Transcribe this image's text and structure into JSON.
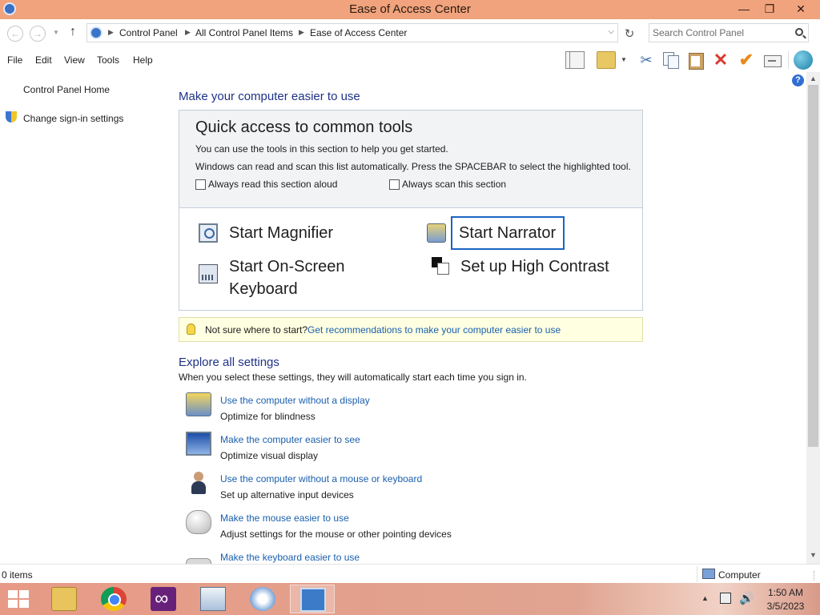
{
  "window": {
    "title": "Ease of Access Center",
    "controls": {
      "minimize": "—",
      "maximize": "❐",
      "close": "✕"
    }
  },
  "address_bar": {
    "breadcrumbs": [
      "Control Panel",
      "All Control Panel Items",
      "Ease of Access Center"
    ],
    "search_placeholder": "Search Control Panel"
  },
  "menu": [
    "File",
    "Edit",
    "View",
    "Tools",
    "Help"
  ],
  "toolbar_icons": [
    "layout-icon",
    "folder-options-icon",
    "cut-icon",
    "copy-icon",
    "paste-icon",
    "delete-icon",
    "check-icon",
    "properties-icon",
    "globe-icon"
  ],
  "sidebar": {
    "items": [
      {
        "label": "Control Panel Home"
      },
      {
        "label": "Change sign-in settings",
        "icon": "shield-icon"
      }
    ]
  },
  "main": {
    "heading": "Make your computer easier to use",
    "quick_access": {
      "title": "Quick access to common tools",
      "desc1": "You can use the tools in this section to help you get started.",
      "desc2": "Windows can read and scan this list automatically.  Press the SPACEBAR to select the highlighted tool.",
      "checkbox_read": {
        "label": "Always read this section aloud",
        "checked": false
      },
      "checkbox_scan": {
        "label": "Always scan this section",
        "checked": false
      },
      "tools": {
        "magnifier": "Start Magnifier",
        "narrator": "Start Narrator",
        "osk_line1": "Start On-Screen",
        "osk_line2": "Keyboard",
        "contrast": "Set up High Contrast"
      }
    },
    "tip": {
      "text": "Not sure where to start?",
      "link": "Get recommendations to make your computer easier to use"
    },
    "explore": {
      "heading": "Explore all settings",
      "desc": "When you select these settings, they will automatically start each time you sign in.",
      "items": [
        {
          "link": "Use the computer without a display",
          "sub": "Optimize for blindness"
        },
        {
          "link": "Make the computer easier to see",
          "sub": "Optimize visual display"
        },
        {
          "link": "Use the computer without a mouse or keyboard",
          "sub": "Set up alternative input devices"
        },
        {
          "link": "Make the mouse easier to use",
          "sub": "Adjust settings for the mouse or other pointing devices"
        },
        {
          "link": "Make the keyboard easier to use"
        }
      ]
    }
  },
  "status_bar": {
    "items": "0 items",
    "location": "Computer"
  },
  "taskbar": {
    "apps": [
      "file-explorer",
      "google-chrome",
      "visual-studio",
      "resource-monitor",
      "setup",
      "control-panel"
    ],
    "active_app": "control-panel",
    "time": "1:50 AM",
    "date": "3/5/2023"
  },
  "colors": {
    "title_bar": "#f0a37c",
    "heading": "#1e3287",
    "link": "#1a5fae",
    "focus_border": "#1b65c4",
    "tip_background": "#ffffe1"
  }
}
